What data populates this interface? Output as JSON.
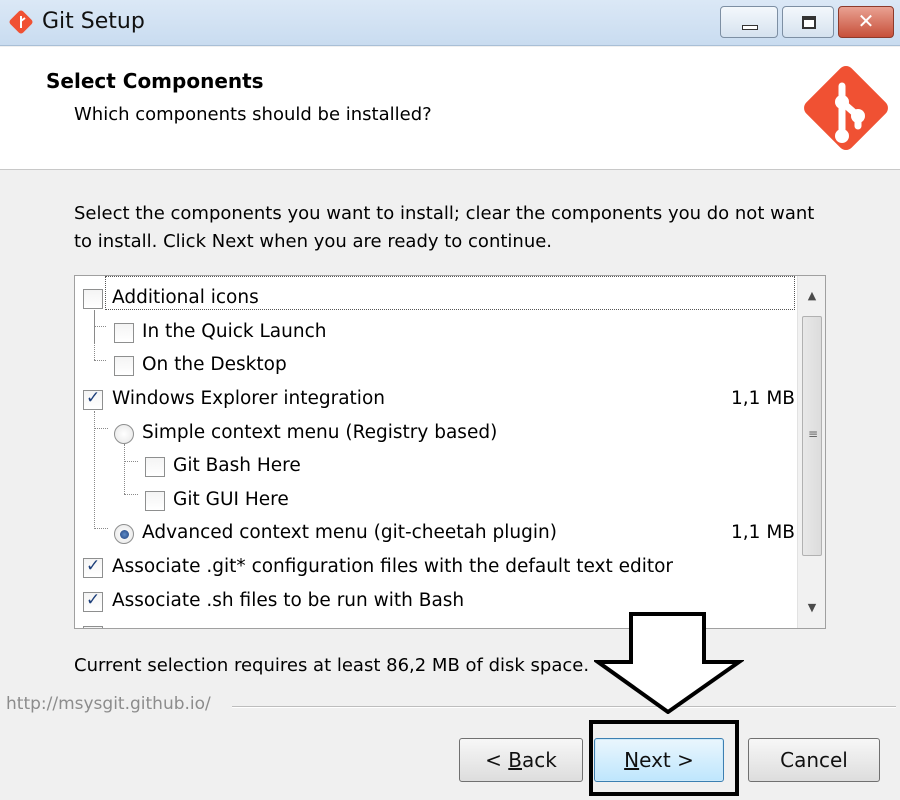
{
  "window": {
    "title": "Git Setup",
    "icons": {
      "app": "git-logo-icon",
      "minimize": "minimize-icon",
      "maximize": "maximize-icon",
      "close": "close-icon"
    }
  },
  "header": {
    "title": "Select Components",
    "subtitle": "Which components should be installed?",
    "logo": "git-logo-icon",
    "brand_color": "#f05133"
  },
  "instructions": "Select the components you want to install; clear the components you do not want to install. Click Next when you are ready to continue.",
  "components": [
    {
      "label": "Additional icons",
      "control": "checkbox",
      "checked": false,
      "level": 0,
      "size": ""
    },
    {
      "label": "In the Quick Launch",
      "control": "checkbox",
      "checked": false,
      "level": 1,
      "size": ""
    },
    {
      "label": "On the Desktop",
      "control": "checkbox",
      "checked": false,
      "level": 1,
      "size": ""
    },
    {
      "label": "Windows Explorer integration",
      "control": "checkbox",
      "checked": true,
      "level": 0,
      "size": "1,1 MB"
    },
    {
      "label": "Simple context menu (Registry based)",
      "control": "radio",
      "checked": false,
      "level": 1,
      "size": ""
    },
    {
      "label": "Git Bash Here",
      "control": "checkbox",
      "checked": false,
      "level": 2,
      "size": ""
    },
    {
      "label": "Git GUI Here",
      "control": "checkbox",
      "checked": false,
      "level": 2,
      "size": ""
    },
    {
      "label": "Advanced context menu (git-cheetah plugin)",
      "control": "radio",
      "checked": true,
      "level": 1,
      "size": "1,1 MB"
    },
    {
      "label": "Associate .git* configuration files with the default text editor",
      "control": "checkbox",
      "checked": true,
      "level": 0,
      "size": ""
    },
    {
      "label": "Associate .sh files to be run with Bash",
      "control": "checkbox",
      "checked": true,
      "level": 0,
      "size": ""
    }
  ],
  "disk_space": "Current selection requires at least 86,2 MB of disk space.",
  "footer": {
    "url": "http://msysgit.github.io/",
    "buttons": {
      "back_prefix": "< ",
      "back_key": "B",
      "back_rest": "ack",
      "next_key": "N",
      "next_rest": "ext >",
      "cancel": "Cancel"
    }
  },
  "scrollbar_icons": {
    "up": "scroll-up-arrow-icon",
    "down": "scroll-down-arrow-icon",
    "grip": "scroll-grip-icon"
  },
  "annotation": {
    "arrow": "down-arrow-icon",
    "target": "next-button"
  }
}
